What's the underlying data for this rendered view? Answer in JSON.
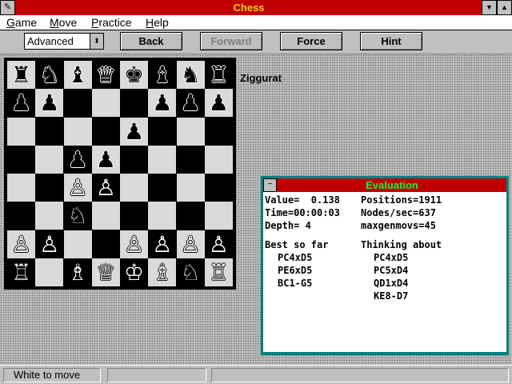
{
  "window": {
    "title": "Chess",
    "sys_icon": "✎",
    "min_icon": "▼",
    "max_icon": "▲"
  },
  "menu": [
    {
      "key": "G",
      "rest": "ame"
    },
    {
      "key": "M",
      "rest": "ove"
    },
    {
      "key": "P",
      "rest": "ractice"
    },
    {
      "key": "H",
      "rest": "elp"
    }
  ],
  "toolbar": {
    "level": "Advanced",
    "level_arrow": "⬍",
    "back": "Back",
    "forward": "Forward",
    "force": "Force",
    "hint": "Hint"
  },
  "board": {
    "ranks": [
      [
        "♜",
        "♞",
        "♝",
        "♛",
        "♚",
        "♝",
        "♞",
        "♜"
      ],
      [
        "♟",
        "♟",
        "",
        "",
        "",
        "♟",
        "♟",
        "♟"
      ],
      [
        "",
        "",
        "",
        "",
        "♟",
        "",
        "",
        ""
      ],
      [
        "",
        "",
        "♟",
        "♟",
        "",
        "",
        "",
        ""
      ],
      [
        "",
        "",
        "♙",
        "♙",
        "",
        "",
        "",
        ""
      ],
      [
        "",
        "",
        "♘",
        "",
        "",
        "",
        "",
        ""
      ],
      [
        "♙",
        "♙",
        "",
        "",
        "♙",
        "♙",
        "♙",
        "♙"
      ],
      [
        "♖",
        "",
        "♗",
        "♕",
        "♔",
        "♗",
        "♘",
        "♖"
      ]
    ],
    "colors": [
      [
        "b",
        "b",
        "b",
        "b",
        "b",
        "b",
        "b",
        "b"
      ],
      [
        "b",
        "b",
        "",
        "",
        "",
        "b",
        "b",
        "b"
      ],
      [
        "",
        "",
        "",
        "",
        "b",
        "",
        "",
        ""
      ],
      [
        "",
        "",
        "b",
        "b",
        "",
        "",
        "",
        ""
      ],
      [
        "",
        "",
        "w",
        "w",
        "",
        "",
        "",
        ""
      ],
      [
        "",
        "",
        "w",
        "",
        "",
        "",
        "",
        ""
      ],
      [
        "w",
        "w",
        "",
        "",
        "w",
        "w",
        "w",
        "w"
      ],
      [
        "w",
        "",
        "w",
        "w",
        "w",
        "w",
        "w",
        "w"
      ]
    ]
  },
  "opening_name": "Ziggurat",
  "evaluation": {
    "title": "Evaluation",
    "sys_icon": "−",
    "value_line": "Value=  0.138",
    "positions_line": "Positions=1911",
    "time_line": "Time=00:00:03",
    "nodes_line": "Nodes/sec=637",
    "depth_line": "Depth= 4",
    "maxgen_line": "maxgenmovs=45",
    "best_header": "Best so far",
    "thinking_header": "Thinking about",
    "best_moves": [
      "PC4xD5",
      "PE6xD5",
      "BC1-G5"
    ],
    "thinking_moves": [
      "PC4xD5",
      "PC5xD4",
      "QD1xD4",
      "KE8-D7"
    ]
  },
  "status": {
    "message": "White to move",
    "box2": "",
    "box3": ""
  }
}
